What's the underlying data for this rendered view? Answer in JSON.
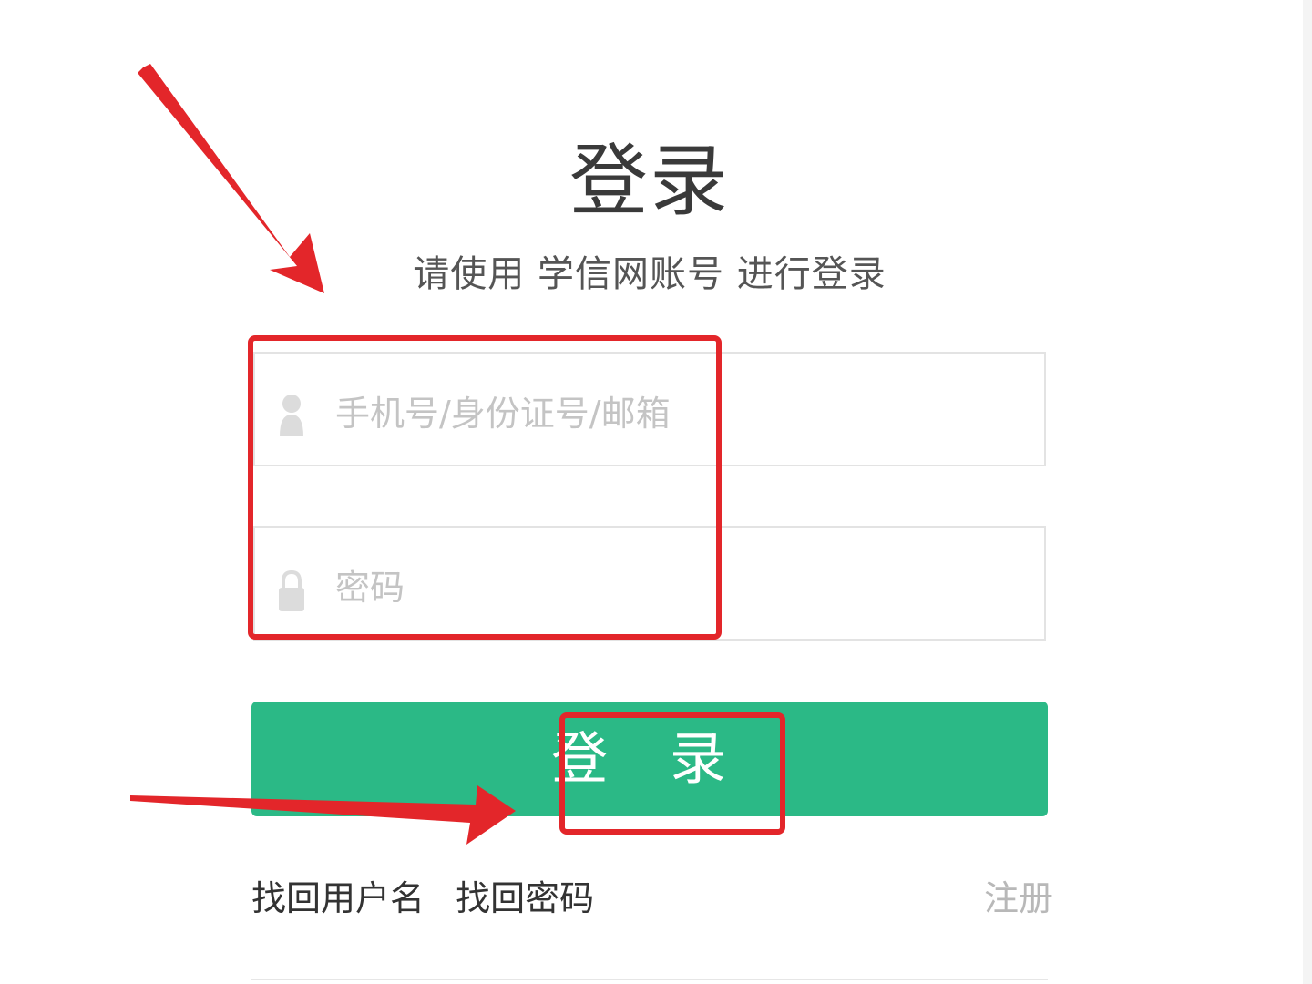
{
  "login": {
    "title": "登录",
    "subtitle": "请使用 学信网账号 进行登录",
    "username_placeholder": "手机号/身份证号/邮箱",
    "username_value": "",
    "password_placeholder": "密码",
    "password_value": "",
    "login_button": "登 录",
    "find_username": "找回用户名",
    "find_password": "找回密码",
    "register": "注册"
  },
  "icons": {
    "username": "user-icon",
    "password": "lock-icon"
  },
  "colors": {
    "primary_button": "#2bb986",
    "annotation": "#e3262a"
  }
}
